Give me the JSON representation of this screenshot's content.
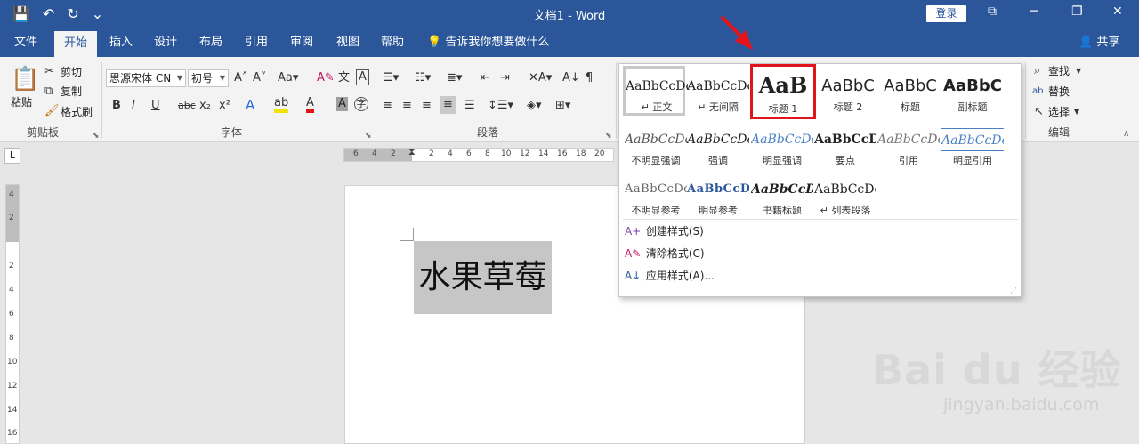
{
  "titlebar": {
    "title": "文档1  -  Word",
    "qat": [
      "💾",
      "↶",
      "↻",
      "⌄"
    ],
    "login_label": "登录",
    "window_controls": [
      "⧉",
      "─",
      "❐",
      "✕"
    ]
  },
  "tabs": {
    "items": [
      "文件",
      "开始",
      "插入",
      "设计",
      "布局",
      "引用",
      "审阅",
      "视图",
      "帮助"
    ],
    "tellme": "💡 告诉我你想要做什么",
    "share": "👤 共享"
  },
  "ribbon": {
    "clipboard": {
      "paste": "粘贴",
      "cut": "剪切",
      "copy": "复制",
      "format_painter": "格式刷",
      "label": "剪贴板"
    },
    "font": {
      "font_name": "思源宋体 CN",
      "font_size": "初号",
      "label": "字体",
      "buttons": [
        "B",
        "I",
        "U",
        "abc",
        "x₂",
        "x²"
      ]
    },
    "paragraph": {
      "label": "段落"
    },
    "editing": {
      "find": "查找",
      "replace": "替换",
      "select": "选择",
      "label": "编辑"
    }
  },
  "ruler": {
    "h_ticks": [
      "6",
      "4",
      "2",
      "2",
      "4",
      "6",
      "8",
      "10",
      "12",
      "14",
      "16",
      "18",
      "20",
      "22"
    ],
    "v_ticks": [
      "4",
      "2",
      "2",
      "4",
      "6",
      "8",
      "10",
      "12",
      "14",
      "16"
    ],
    "corner": "L"
  },
  "document": {
    "selected_text": "水果草莓"
  },
  "gallery": {
    "styles": [
      {
        "sample": "AaBbCcDc",
        "name": "↵ 正文"
      },
      {
        "sample": "AaBbCcDc",
        "name": "↵ 无间隔"
      },
      {
        "sample": "AaB",
        "name": "标题 1"
      },
      {
        "sample": "AaBbC",
        "name": "标题 2"
      },
      {
        "sample": "AaBbC",
        "name": "标题"
      },
      {
        "sample": "AaBbC",
        "name": "副标题"
      },
      {
        "sample": "AaBbCcDc",
        "name": "不明显强调"
      },
      {
        "sample": "AaBbCcDc",
        "name": "强调"
      },
      {
        "sample": "AaBbCcDc",
        "name": "明显强调"
      },
      {
        "sample": "AaBbCcDc",
        "name": "要点"
      },
      {
        "sample": "AaBbCcDc",
        "name": "引用"
      },
      {
        "sample": "AaBbCcDc",
        "name": "明显引用"
      },
      {
        "sample": "AaBbCcDc",
        "name": "不明显参考"
      },
      {
        "sample": "AaBbCcDc",
        "name": "明显参考"
      },
      {
        "sample": "AaBbCcDc",
        "name": "书籍标题"
      },
      {
        "sample": "AaBbCcDc",
        "name": "↵ 列表段落"
      }
    ],
    "commands": [
      {
        "icon": "A+",
        "label": "创建样式(S)"
      },
      {
        "icon": "A✎",
        "label": "清除格式(C)"
      },
      {
        "icon": "A↓",
        "label": "应用样式(A)..."
      }
    ]
  },
  "watermark": {
    "brand": "Bai du 经验",
    "url": "jingyan.baidu.com"
  },
  "colors": {
    "accent": "#2b579a",
    "highlight_border": "#e0141b"
  }
}
